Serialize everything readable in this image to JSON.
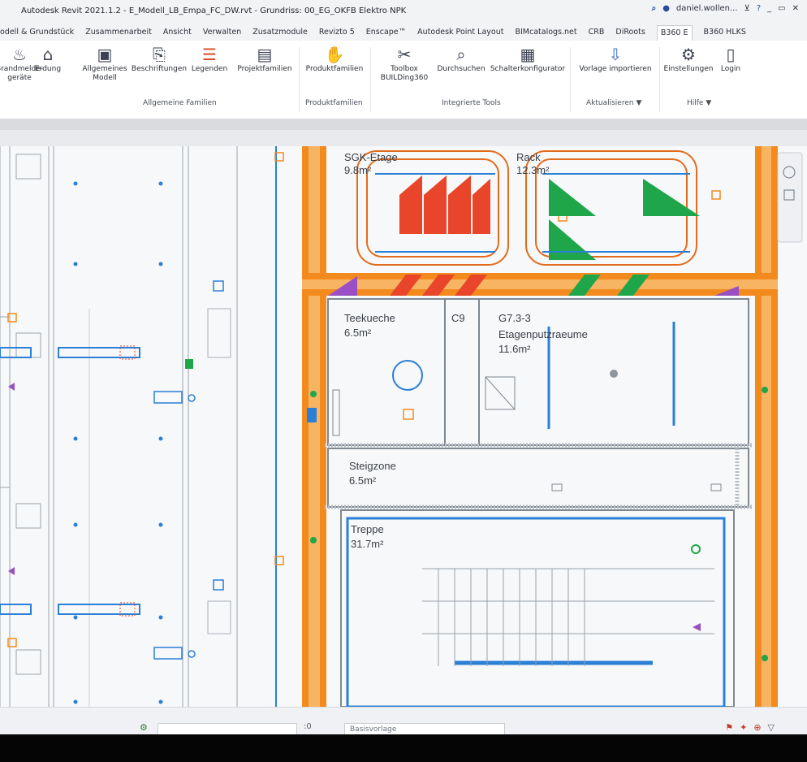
{
  "window": {
    "title": "Autodesk Revit 2021.1.2 - E_Modell_LB_Empa_FC_DW.rvt - Grundriss: 00_EG_OKFB Elektro NPK",
    "user": "daniel.wollen...",
    "help": "?"
  },
  "menu": {
    "tabs": [
      {
        "label": "odell & Grundstück"
      },
      {
        "label": "Zusammenarbeit"
      },
      {
        "label": "Ansicht"
      },
      {
        "label": "Verwalten"
      },
      {
        "label": "Zusatzmodule"
      },
      {
        "label": "Revizto 5"
      },
      {
        "label": "Enscape™"
      },
      {
        "label": "Autodesk Point Layout"
      },
      {
        "label": "BIMcatalogs.net"
      },
      {
        "label": "CRB"
      },
      {
        "label": "DiRoots"
      },
      {
        "label": "B360 E"
      },
      {
        "label": "B360 HLKS"
      }
    ]
  },
  "ribbon": {
    "buttons": {
      "brandmelde": "Brandmelde-\ngeräte",
      "erdung": "Erdung",
      "allgemeines_modell": "Allgemeines\nModell",
      "beschriftungen": "Beschriftungen",
      "legenden": "Legenden",
      "projektfamilien": "Projektfamilien",
      "produktfamilien": "Produktfamilien",
      "toolbox": "Toolbox\nBUILDing360",
      "durchsuchen": "Durchsuchen",
      "schalterkonfigurator": "Schalterkonfigurator",
      "vorlage_importieren": "Vorlage importieren",
      "einstellungen": "Einstellungen",
      "login": "Login"
    },
    "groups": {
      "allgemeine_familien": "Allgemeine Familien",
      "produktfamilien": "Produktfamilien",
      "integrierte_tools": "Integrierte Tools",
      "aktualisieren": "Aktualisieren ▼",
      "hilfe": "Hilfe ▼"
    }
  },
  "rooms": {
    "sgk": {
      "name": "SGK-Etage",
      "area": "9.8m²"
    },
    "rack": {
      "name": "Rack",
      "area": "12.3m²"
    },
    "teekueche": {
      "name": "Teekueche",
      "area": "6.5m²"
    },
    "c9": {
      "name": "C9"
    },
    "g73": {
      "name": "G7.3-3",
      "label": "Etagenputzraeume",
      "area": "11.6m²"
    },
    "steigzone": {
      "name": "Steigzone",
      "area": "6.5m²"
    },
    "treppe": {
      "name": "Treppe",
      "area": "31.7m²"
    }
  },
  "statusbar": {
    "workset": "Basisvorlage",
    "zero": ":0"
  },
  "colors": {
    "orange": "#f28a1e",
    "red": "#e8452a",
    "green": "#1fa64a",
    "blue": "#2a7fd6",
    "purple": "#9a4fc4"
  }
}
